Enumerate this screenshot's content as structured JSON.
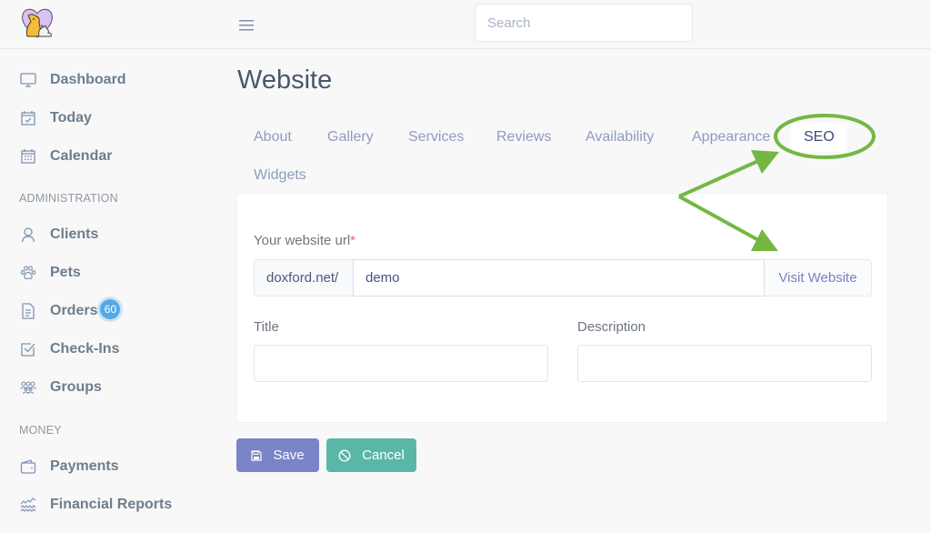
{
  "header": {
    "search_placeholder": "Search"
  },
  "sidebar": {
    "items_top": [
      {
        "label": "Dashboard",
        "icon": "monitor-icon"
      },
      {
        "label": "Today",
        "icon": "calendar-check-icon"
      },
      {
        "label": "Calendar",
        "icon": "calendar-grid-icon"
      }
    ],
    "section_admin": "ADMINISTRATION",
    "items_admin": [
      {
        "label": "Clients",
        "icon": "user-icon"
      },
      {
        "label": "Pets",
        "icon": "paw-icon"
      },
      {
        "label": "Orders",
        "icon": "document-icon",
        "badge": "60"
      },
      {
        "label": "Check-Ins",
        "icon": "checkbox-icon"
      },
      {
        "label": "Groups",
        "icon": "group-icon"
      }
    ],
    "section_money": "MONEY",
    "items_money": [
      {
        "label": "Payments",
        "icon": "wallet-icon"
      },
      {
        "label": "Financial Reports",
        "icon": "chart-wave-icon"
      }
    ]
  },
  "main": {
    "title": "Website",
    "tabs": [
      {
        "label": "About",
        "active": false
      },
      {
        "label": "Gallery",
        "active": false
      },
      {
        "label": "Services",
        "active": false
      },
      {
        "label": "Reviews",
        "active": false
      },
      {
        "label": "Availability",
        "active": false
      },
      {
        "label": "Appearance",
        "active": false
      },
      {
        "label": "SEO",
        "active": true
      },
      {
        "label": "Widgets",
        "active": false
      }
    ],
    "form": {
      "url_label": "Your website url",
      "url_required_mark": "*",
      "url_prefix": "doxford.net/",
      "url_value": "demo",
      "visit_label": "Visit Website",
      "title_label": "Title",
      "title_value": "",
      "description_label": "Description",
      "description_value": ""
    },
    "buttons": {
      "save": "Save",
      "cancel": "Cancel"
    }
  },
  "colors": {
    "annotation": "#74b843",
    "badge": "#55a8e6",
    "save_button": "#7a84c7",
    "cancel_button": "#5ab7a8"
  }
}
